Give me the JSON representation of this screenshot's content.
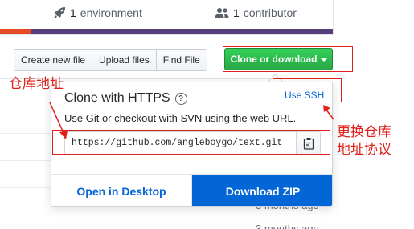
{
  "stats": {
    "environment": {
      "count": "1",
      "label": "environment",
      "icon": "rocket-icon"
    },
    "contributors": {
      "count": "1",
      "label": "contributor",
      "icon": "people-icon"
    }
  },
  "language_bar_colors": {
    "first": "#e34c26",
    "second": "#563d7c"
  },
  "toolbar": {
    "buttons": [
      "Create new file",
      "Upload files",
      "Find File"
    ],
    "clone_label": "Clone or download"
  },
  "file_list": {
    "ages": [
      "3 months ago",
      "3 months ago"
    ]
  },
  "clone_popover": {
    "title": "Clone with HTTPS",
    "help_glyph": "?",
    "switch_link": "Use SSH",
    "description": "Use Git or checkout with SVN using the web URL.",
    "url": "https://github.com/angleboygo/text.git",
    "copy_icon": "clipboard-icon",
    "open_desktop_label": "Open in Desktop",
    "download_zip_label": "Download ZIP"
  },
  "annotations": {
    "repo_address": "仓库地址",
    "switch_protocol": "更换仓库\n地址协议",
    "color": "#e0201a"
  }
}
